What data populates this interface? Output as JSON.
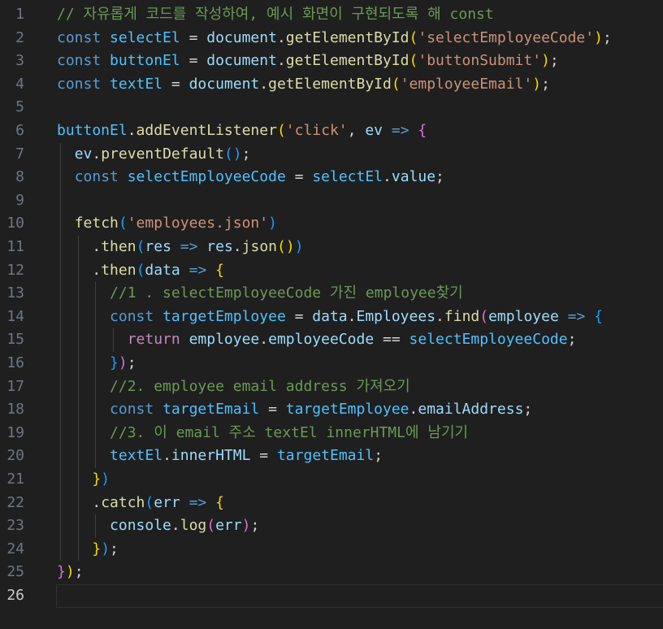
{
  "editor": {
    "language": "javascript",
    "active_line": 26,
    "lines": [
      {
        "n": "1",
        "tokens": [
          [
            "// 자유롭게 코드를 작성하여, 예시 화면이 구현되도록 해 const",
            "cm"
          ]
        ]
      },
      {
        "n": "2",
        "tokens": [
          [
            "const ",
            "kw"
          ],
          [
            "selectEl",
            "cn"
          ],
          [
            " = ",
            "op"
          ],
          [
            "document",
            "vr"
          ],
          [
            ".",
            "op"
          ],
          [
            "getElementById",
            "fn"
          ],
          [
            "(",
            "b1"
          ],
          [
            "'selectEmployeeCode'",
            "st"
          ],
          [
            ")",
            "b1"
          ],
          [
            ";",
            "op"
          ]
        ]
      },
      {
        "n": "3",
        "tokens": [
          [
            "const ",
            "kw"
          ],
          [
            "buttonEl",
            "cn"
          ],
          [
            " = ",
            "op"
          ],
          [
            "document",
            "vr"
          ],
          [
            ".",
            "op"
          ],
          [
            "getElementById",
            "fn"
          ],
          [
            "(",
            "b1"
          ],
          [
            "'buttonSubmit'",
            "st"
          ],
          [
            ")",
            "b1"
          ],
          [
            ";",
            "op"
          ]
        ]
      },
      {
        "n": "4",
        "tokens": [
          [
            "const ",
            "kw"
          ],
          [
            "textEl",
            "cn"
          ],
          [
            " = ",
            "op"
          ],
          [
            "document",
            "vr"
          ],
          [
            ".",
            "op"
          ],
          [
            "getElementById",
            "fn"
          ],
          [
            "(",
            "b1"
          ],
          [
            "'employeeEmail'",
            "st"
          ],
          [
            ")",
            "b1"
          ],
          [
            ";",
            "op"
          ]
        ]
      },
      {
        "n": "5",
        "tokens": []
      },
      {
        "n": "6",
        "tokens": [
          [
            "buttonEl",
            "cn"
          ],
          [
            ".",
            "op"
          ],
          [
            "addEventListener",
            "fn"
          ],
          [
            "(",
            "b1"
          ],
          [
            "'click'",
            "st"
          ],
          [
            ", ",
            "op"
          ],
          [
            "ev",
            "vr"
          ],
          [
            " => ",
            "kw"
          ],
          [
            "{",
            "b2"
          ]
        ]
      },
      {
        "n": "7",
        "tokens": [
          [
            "  ",
            "op"
          ],
          [
            "ev",
            "vr"
          ],
          [
            ".",
            "op"
          ],
          [
            "preventDefault",
            "fn"
          ],
          [
            "()",
            "b3"
          ],
          [
            ";",
            "op"
          ]
        ]
      },
      {
        "n": "8",
        "tokens": [
          [
            "  ",
            "op"
          ],
          [
            "const ",
            "kw"
          ],
          [
            "selectEmployeeCode",
            "cn"
          ],
          [
            " = ",
            "op"
          ],
          [
            "selectEl",
            "cn"
          ],
          [
            ".",
            "op"
          ],
          [
            "value",
            "vr"
          ],
          [
            ";",
            "op"
          ]
        ]
      },
      {
        "n": "9",
        "tokens": []
      },
      {
        "n": "10",
        "tokens": [
          [
            "  ",
            "op"
          ],
          [
            "fetch",
            "fn"
          ],
          [
            "(",
            "b3"
          ],
          [
            "'employees.json'",
            "st"
          ],
          [
            ")",
            "b3"
          ]
        ]
      },
      {
        "n": "11",
        "tokens": [
          [
            "    ",
            "op"
          ],
          [
            ".",
            "op"
          ],
          [
            "then",
            "fn"
          ],
          [
            "(",
            "b3"
          ],
          [
            "res",
            "vr"
          ],
          [
            " => ",
            "kw"
          ],
          [
            "res",
            "vr"
          ],
          [
            ".",
            "op"
          ],
          [
            "json",
            "fn"
          ],
          [
            "()",
            "b1"
          ],
          [
            ")",
            "b3"
          ]
        ]
      },
      {
        "n": "12",
        "tokens": [
          [
            "    ",
            "op"
          ],
          [
            ".",
            "op"
          ],
          [
            "then",
            "fn"
          ],
          [
            "(",
            "b3"
          ],
          [
            "data",
            "vr"
          ],
          [
            " => ",
            "kw"
          ],
          [
            "{",
            "b1"
          ]
        ]
      },
      {
        "n": "13",
        "tokens": [
          [
            "      ",
            "op"
          ],
          [
            "//1 . selectEmployeeCode 가진 employee찾기",
            "cm"
          ]
        ]
      },
      {
        "n": "14",
        "tokens": [
          [
            "      ",
            "op"
          ],
          [
            "const ",
            "kw"
          ],
          [
            "targetEmployee",
            "cn"
          ],
          [
            " = ",
            "op"
          ],
          [
            "data",
            "vr"
          ],
          [
            ".",
            "op"
          ],
          [
            "Employees",
            "vr"
          ],
          [
            ".",
            "op"
          ],
          [
            "find",
            "fn"
          ],
          [
            "(",
            "b2"
          ],
          [
            "employee",
            "vr"
          ],
          [
            " => ",
            "kw"
          ],
          [
            "{",
            "b3"
          ]
        ]
      },
      {
        "n": "15",
        "tokens": [
          [
            "        ",
            "op"
          ],
          [
            "return ",
            "ct"
          ],
          [
            "employee",
            "vr"
          ],
          [
            ".",
            "op"
          ],
          [
            "employeeCode",
            "vr"
          ],
          [
            " == ",
            "op"
          ],
          [
            "selectEmployeeCode",
            "cn"
          ],
          [
            ";",
            "op"
          ]
        ]
      },
      {
        "n": "16",
        "tokens": [
          [
            "      ",
            "op"
          ],
          [
            "}",
            "b3"
          ],
          [
            ")",
            "b2"
          ],
          [
            ";",
            "op"
          ]
        ]
      },
      {
        "n": "17",
        "tokens": [
          [
            "      ",
            "op"
          ],
          [
            "//2. employee email address 가져오기",
            "cm"
          ]
        ]
      },
      {
        "n": "18",
        "tokens": [
          [
            "      ",
            "op"
          ],
          [
            "const ",
            "kw"
          ],
          [
            "targetEmail",
            "cn"
          ],
          [
            " = ",
            "op"
          ],
          [
            "targetEmployee",
            "cn"
          ],
          [
            ".",
            "op"
          ],
          [
            "emailAddress",
            "vr"
          ],
          [
            ";",
            "op"
          ]
        ]
      },
      {
        "n": "19",
        "tokens": [
          [
            "      ",
            "op"
          ],
          [
            "//3. 이 email 주소 textEl innerHTML에 남기기",
            "cm"
          ]
        ]
      },
      {
        "n": "20",
        "tokens": [
          [
            "      ",
            "op"
          ],
          [
            "textEl",
            "cn"
          ],
          [
            ".",
            "op"
          ],
          [
            "innerHTML",
            "vr"
          ],
          [
            " = ",
            "op"
          ],
          [
            "targetEmail",
            "cn"
          ],
          [
            ";",
            "op"
          ]
        ]
      },
      {
        "n": "21",
        "tokens": [
          [
            "    ",
            "op"
          ],
          [
            "}",
            "b1"
          ],
          [
            ")",
            "b3"
          ]
        ]
      },
      {
        "n": "22",
        "tokens": [
          [
            "    ",
            "op"
          ],
          [
            ".",
            "op"
          ],
          [
            "catch",
            "fn"
          ],
          [
            "(",
            "b3"
          ],
          [
            "err",
            "vr"
          ],
          [
            " => ",
            "kw"
          ],
          [
            "{",
            "b1"
          ]
        ]
      },
      {
        "n": "23",
        "tokens": [
          [
            "      ",
            "op"
          ],
          [
            "console",
            "vr"
          ],
          [
            ".",
            "op"
          ],
          [
            "log",
            "fn"
          ],
          [
            "(",
            "b2"
          ],
          [
            "err",
            "vr"
          ],
          [
            ")",
            "b2"
          ],
          [
            ";",
            "op"
          ]
        ]
      },
      {
        "n": "24",
        "tokens": [
          [
            "    ",
            "op"
          ],
          [
            "}",
            "b1"
          ],
          [
            ")",
            "b3"
          ],
          [
            ";",
            "op"
          ]
        ]
      },
      {
        "n": "25",
        "tokens": [
          [
            "}",
            "b2"
          ],
          [
            ")",
            "b1"
          ],
          [
            ";",
            "op"
          ]
        ]
      },
      {
        "n": "26",
        "tokens": []
      }
    ]
  }
}
